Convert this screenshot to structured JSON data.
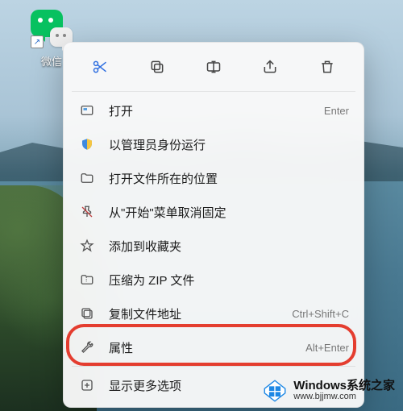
{
  "desktop": {
    "icon_label": "微信"
  },
  "context_menu": {
    "actions": {
      "cut": "cut",
      "copy": "copy",
      "rename": "rename",
      "share": "share",
      "delete": "delete"
    },
    "items": [
      {
        "label": "打开",
        "shortcut": "Enter"
      },
      {
        "label": "以管理员身份运行",
        "shortcut": ""
      },
      {
        "label": "打开文件所在的位置",
        "shortcut": ""
      },
      {
        "label": "从\"开始\"菜单取消固定",
        "shortcut": ""
      },
      {
        "label": "添加到收藏夹",
        "shortcut": ""
      },
      {
        "label": "压缩为 ZIP 文件",
        "shortcut": ""
      },
      {
        "label": "复制文件地址",
        "shortcut": "Ctrl+Shift+C"
      },
      {
        "label": "属性",
        "shortcut": "Alt+Enter"
      },
      {
        "label": "显示更多选项",
        "shortcut": ""
      }
    ]
  },
  "watermark": {
    "title": "Windows系统之家",
    "url": "www.bjjmw.com"
  },
  "highlighted_item_index": 7
}
